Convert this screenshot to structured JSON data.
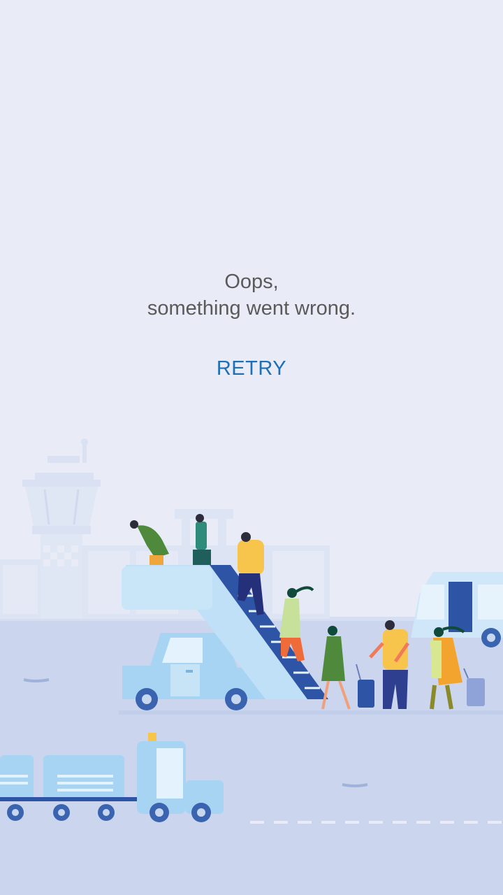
{
  "error": {
    "title_line1": "Oops,",
    "title_line2": "something went wrong."
  },
  "actions": {
    "retry_label": "RETRY"
  },
  "colors": {
    "background": "#e9ecf6",
    "text": "#5a5a5a",
    "accent": "#1f6fb5"
  },
  "illustration": {
    "icon": "airport-boarding-illustration"
  }
}
